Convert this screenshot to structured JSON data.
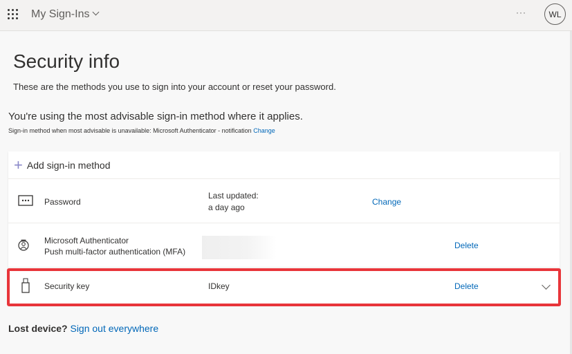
{
  "header": {
    "app_title": "My Sign-Ins",
    "more": "···",
    "avatar_initials": "WL"
  },
  "page": {
    "title": "Security info",
    "subtitle": "These are the methods you use to sign into your account or reset your password.",
    "advisable": "You're using the most advisable sign-in method where it applies.",
    "fallback_text": "Sign-in method when most advisable is unavailable: Microsoft Authenticator - notification",
    "fallback_change": "Change"
  },
  "methods": {
    "add_label": "Add sign-in method",
    "password": {
      "name": "Password",
      "detail_label": "Last updated:",
      "detail_value": "a day ago",
      "action": "Change"
    },
    "authenticator": {
      "name": "Microsoft Authenticator",
      "subtitle": "Push multi-factor authentication (MFA)",
      "action": "Delete"
    },
    "security_key": {
      "name": "Security key",
      "detail": "IDkey",
      "action": "Delete"
    }
  },
  "footer": {
    "lost_device": "Lost device?",
    "sign_out": "Sign out everywhere"
  },
  "colors": {
    "link": "#0067b8",
    "highlight": "#e8353a"
  }
}
